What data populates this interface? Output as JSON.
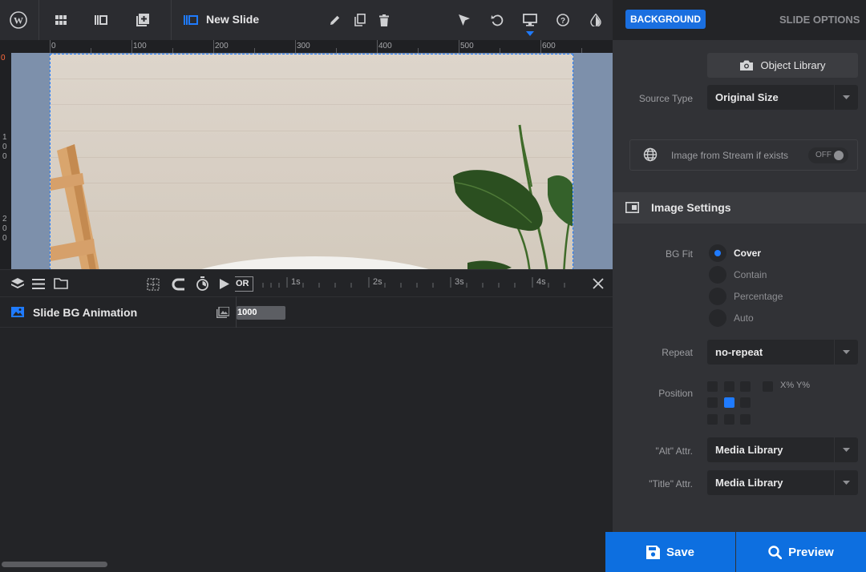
{
  "toolbar": {
    "slide_name": "New Slide"
  },
  "ruler": {
    "h_labels": [
      "0",
      "100",
      "200",
      "300",
      "400",
      "500",
      "600"
    ],
    "v_labels": [
      "0",
      "100",
      "200"
    ]
  },
  "timeline": {
    "ticks": [
      "1s",
      "2s",
      "3s",
      "4s"
    ],
    "partial_label": "OR",
    "layer_name": "Slide BG Animation",
    "duration_value": "1000"
  },
  "panel": {
    "tab_active": "BACKGROUND",
    "tab_other": "SLIDE OPTIONS",
    "object_library_label": "Object Library",
    "source_type": {
      "label": "Source Type",
      "value": "Original Size"
    },
    "stream": {
      "label": "Image from Stream if exists",
      "toggle": "OFF"
    },
    "image_settings_title": "Image Settings",
    "bg_fit": {
      "label": "BG Fit",
      "options": [
        "Cover",
        "Contain",
        "Percentage",
        "Auto"
      ],
      "selected": "Cover"
    },
    "repeat": {
      "label": "Repeat",
      "value": "no-repeat"
    },
    "position": {
      "label": "Position",
      "xy_label": "X% Y%"
    },
    "alt_attr": {
      "label": "\"Alt\" Attr.",
      "value": "Media Library"
    },
    "title_attr": {
      "label": "\"Title\" Attr.",
      "value": "Media Library"
    }
  },
  "actions": {
    "save": "Save",
    "preview": "Preview"
  },
  "colors": {
    "accent": "#1a6fe0",
    "canvas_bg": "#7d90ab",
    "panel_bg": "#313236",
    "editor_bg": "#232427"
  }
}
